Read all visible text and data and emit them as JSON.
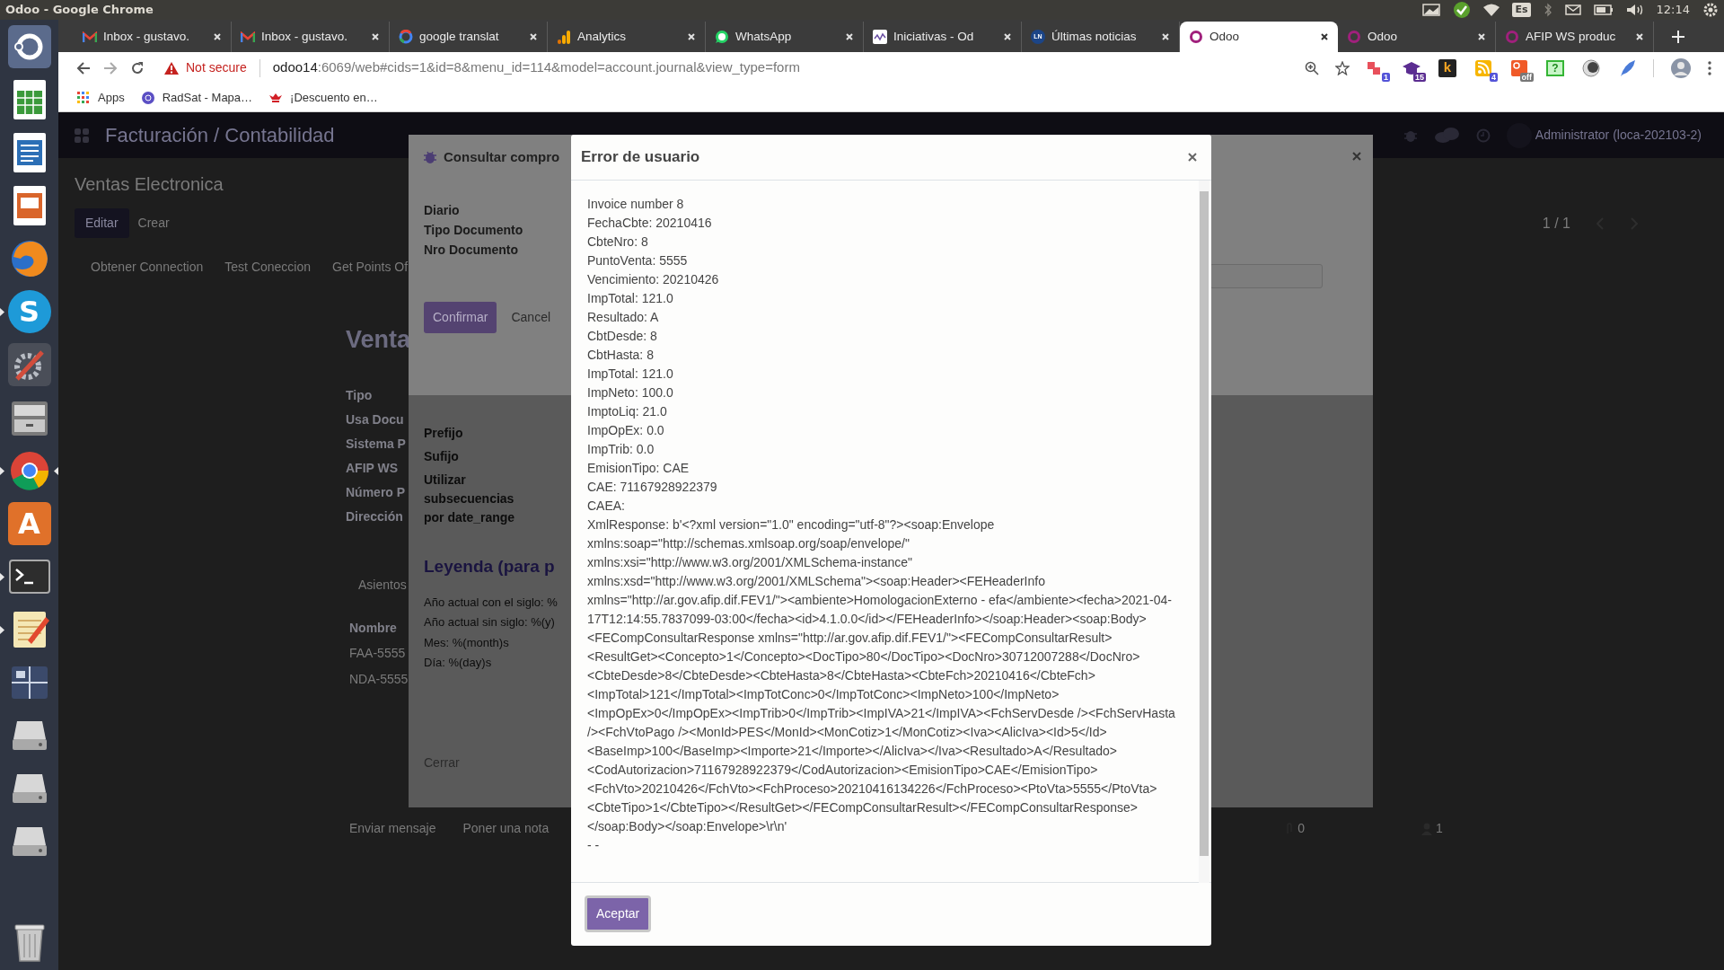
{
  "os_bar": {
    "title": "Odoo - Google Chrome",
    "keyboard": "Es",
    "time": "12:14"
  },
  "dock": [
    {
      "kind": "dash",
      "running": false,
      "focused": false
    },
    {
      "kind": "calc",
      "running": false,
      "focused": false
    },
    {
      "kind": "writer",
      "running": false,
      "focused": false
    },
    {
      "kind": "impress",
      "running": false,
      "focused": false
    },
    {
      "kind": "firefox",
      "running": false,
      "focused": false
    },
    {
      "kind": "letter",
      "text": "S",
      "running": true,
      "focused": false
    },
    {
      "kind": "tools",
      "running": false,
      "focused": false
    },
    {
      "kind": "cabinet",
      "running": false,
      "focused": false
    },
    {
      "kind": "chrome",
      "running": true,
      "focused": true
    },
    {
      "kind": "bag",
      "text": "A",
      "running": false,
      "focused": false
    },
    {
      "kind": "terminal",
      "running": true,
      "focused": false
    },
    {
      "kind": "editor",
      "running": true,
      "focused": false
    },
    {
      "kind": "switcher",
      "running": false,
      "focused": false
    },
    {
      "kind": "drive",
      "running": false,
      "focused": false
    },
    {
      "kind": "drive",
      "running": false,
      "focused": false
    },
    {
      "kind": "drive",
      "running": false,
      "focused": false
    },
    {
      "kind": "trash",
      "running": false,
      "focused": false
    }
  ],
  "tabs": [
    {
      "kind": "mail",
      "title": "Inbox - gustavo.",
      "selected": false
    },
    {
      "kind": "mail",
      "title": "Inbox - gustavo.",
      "selected": false
    },
    {
      "kind": "google",
      "title": "google translat",
      "selected": false
    },
    {
      "kind": "analytics",
      "title": "Analytics",
      "selected": false
    },
    {
      "kind": "chat",
      "title": "WhatsApp",
      "selected": false
    },
    {
      "kind": "wave",
      "title": "Iniciativas - Od",
      "selected": false
    },
    {
      "kind": "news",
      "mark": "LN",
      "title": "Últimas noticias",
      "selected": false
    },
    {
      "kind": "odoo",
      "title": "Odoo",
      "selected": true
    },
    {
      "kind": "odoo",
      "title": "Odoo",
      "selected": false
    },
    {
      "kind": "odoo",
      "title": "AFIP WS produc",
      "selected": false
    }
  ],
  "address": {
    "warning": "Not secure",
    "host": "odoo14",
    "path": ":6069/web#cids=1&id=8&menu_id=114&model=account.journal&view_type=form"
  },
  "extensions": [
    {
      "kind": "pixel",
      "badge": "1"
    },
    {
      "kind": "hat",
      "badge": "15"
    },
    {
      "kind": "letter",
      "label": "k"
    },
    {
      "kind": "feed",
      "badge": "4"
    },
    {
      "kind": "square",
      "badge": "off"
    },
    {
      "kind": "help",
      "label": "?"
    },
    {
      "kind": "moon"
    },
    {
      "kind": "feather"
    }
  ],
  "bookmarks": [
    {
      "kind": "apps",
      "label": "Apps"
    },
    {
      "kind": "globe",
      "label": "RadSat - Mapa…"
    },
    {
      "kind": "crown",
      "label": "¡Descuento en…"
    }
  ],
  "odoo": {
    "app_title": "Facturación / Contabilidad",
    "user": "Administrator (loca-202103-2)",
    "breadcrumb": "Ventas Electronica",
    "buttons": [
      "Editar",
      "Crear"
    ],
    "pager": "1 / 1",
    "actions": [
      "Obtener Connection",
      "Test Coneccion",
      "Get Points Of"
    ],
    "form_title": "Venta",
    "field_labels": [
      "Tipo",
      "Usa Docu",
      "Sistema P",
      "AFIP WS",
      "Número P",
      "Dirección"
    ],
    "notebook_tab": "Asientos",
    "table_header": "Nombre",
    "table_rows": [
      "FAA-5555",
      "NDA-5555"
    ],
    "chatter": [
      "Enviar mensaje",
      "Poner una nota"
    ],
    "attachments": "0",
    "followers": "1"
  },
  "consult_dialog": {
    "title": "Consultar compro",
    "fields": [
      "Diario",
      "Tipo Documento",
      "Nro Documento"
    ],
    "confirm": "Confirmar",
    "cancel": "Cancel",
    "lower_labels": [
      "Prefijo",
      "Sufijo",
      "Utilizar subsecuencias por date_range"
    ],
    "legend_title": "Leyenda (para p",
    "legend_lines": [
      "Año actual con el siglo: %",
      "Año actual sin siglo: %(y)",
      "Mes: %(month)s",
      "Día: %(day)s"
    ],
    "close": "Cerrar"
  },
  "error_dialog": {
    "title": "Error de usuario",
    "lines": [
      "Invoice number 8",
      "FechaCbte: 20210416",
      "CbteNro: 8",
      "PuntoVenta: 5555",
      "Vencimiento: 20210426",
      "ImpTotal: 121.0",
      "Resultado: A",
      "CbtDesde: 8",
      "CbtHasta: 8",
      "ImpTotal: 121.0",
      "ImpNeto: 100.0",
      "ImptoLiq: 21.0",
      "ImpOpEx: 0.0",
      "ImpTrib: 0.0",
      "EmisionTipo: CAE",
      "CAE: 71167928922379",
      "CAEA:"
    ],
    "xml_response": "XmlResponse: b'<?xml version=\"1.0\" encoding=\"utf-8\"?><soap:Envelope xmlns:soap=\"http://schemas.xmlsoap.org/soap/envelope/\" xmlns:xsi=\"http://www.w3.org/2001/XMLSchema-instance\" xmlns:xsd=\"http://www.w3.org/2001/XMLSchema\"><soap:Header><FEHeaderInfo xmlns=\"http://ar.gov.afip.dif.FEV1/\"><ambiente>HomologacionExterno - efa</ambiente><fecha>2021-04-17T12:14:55.7837099-03:00</fecha><id>4.1.0.0</id></FEHeaderInfo></soap:Header><soap:Body><FECompConsultarResponse xmlns=\"http://ar.gov.afip.dif.FEV1/\"><FECompConsultarResult><ResultGet><Concepto>1</Concepto><DocTipo>80</DocTipo><DocNro>30712007288</DocNro><CbteDesde>8</CbteDesde><CbteHasta>8</CbteHasta><CbteFch>20210416</CbteFch><ImpTotal>121</ImpTotal><ImpTotConc>0</ImpTotConc><ImpNeto>100</ImpNeto><ImpOpEx>0</ImpOpEx><ImpTrib>0</ImpTrib><ImpIVA>21</ImpIVA><FchServDesde /><FchServHasta /><FchVtoPago /><MonId>PES</MonId><MonCotiz>1</MonCotiz><Iva><AlicIva><Id>5</Id><BaseImp>100</BaseImp><Importe>21</Importe></AlicIva></Iva><Resultado>A</Resultado><CodAutorizacion>71167928922379</CodAutorizacion><EmisionTipo>CAE</EmisionTipo><FchVto>20210426</FchVto><FchProceso>20210416134226</FchProceso><PtoVta>5555</PtoVta><CbteTipo>1</CbteTipo></ResultGet></FECompConsultarResult></FECompConsultarResponse></soap:Body></soap:Envelope>\\r\\n'",
    "trailing": "- -",
    "accept": "Aceptar"
  }
}
